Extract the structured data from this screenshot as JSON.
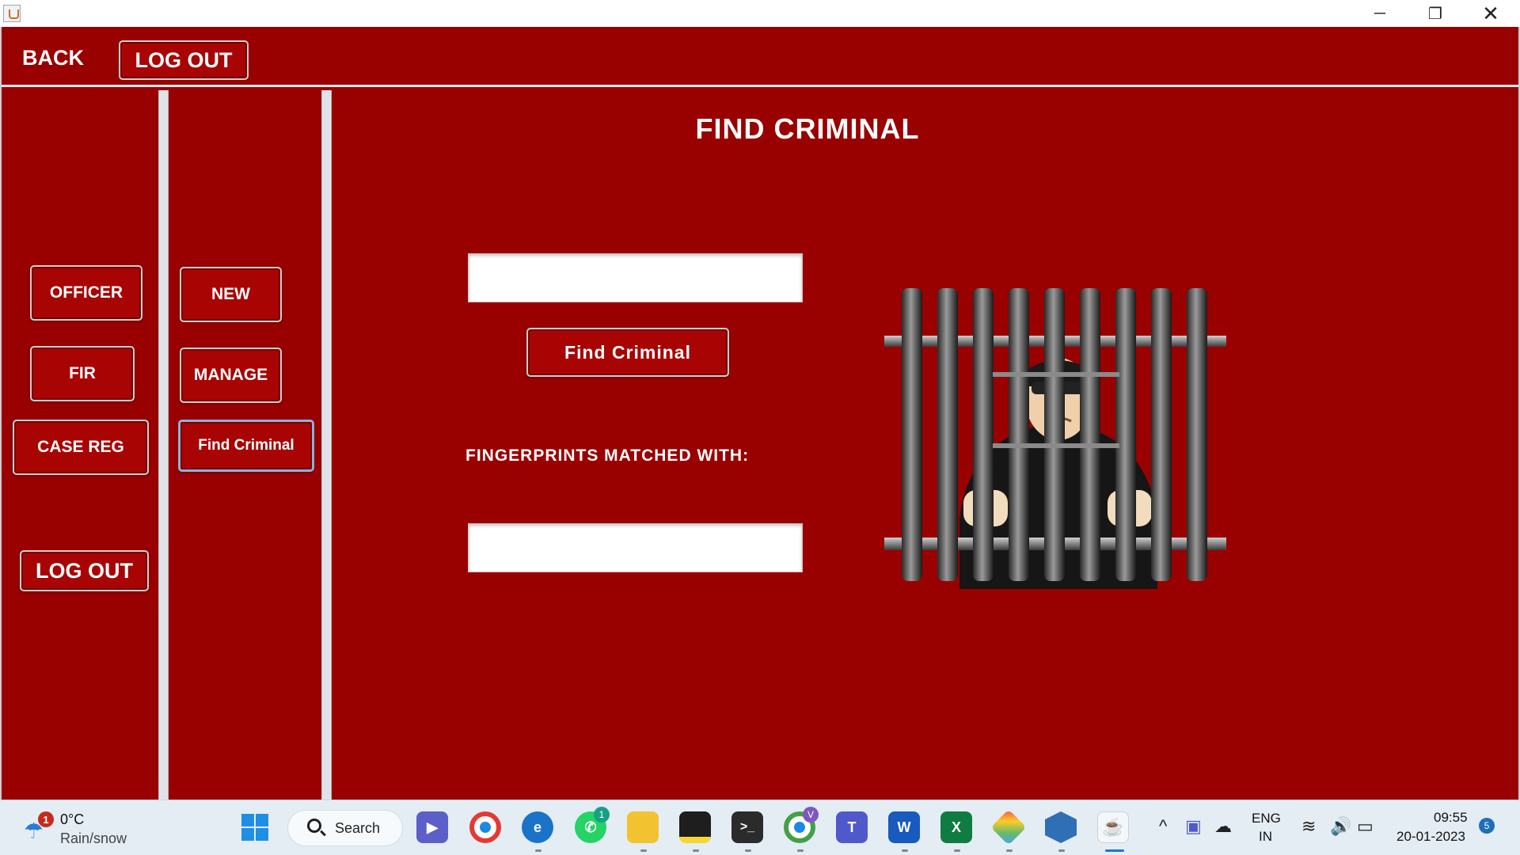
{
  "window": {
    "minimize": "─",
    "maximize": "❐",
    "close": "✕"
  },
  "topbar": {
    "back": "BACK",
    "logout": "LOG OUT"
  },
  "left_menu": {
    "officer": "OFFICER",
    "fir": "FIR",
    "case_reg": "CASE REG",
    "logout": "LOG OUT"
  },
  "sub_menu": {
    "new": "NEW",
    "manage": "MANAGE",
    "find_criminal": "Find Criminal"
  },
  "main": {
    "title": "FIND CRIMINAL",
    "search_value": "",
    "find_button": "Find Criminal",
    "matched_label": "FINGERPRINTS MATCHED WITH:",
    "result_value": ""
  },
  "taskbar": {
    "weather": {
      "badge": "1",
      "temp": "0°C",
      "desc": "Rain/snow"
    },
    "search_label": "Search",
    "whatsapp_badge": "1",
    "chrome_profile_badge": "V",
    "apps": [
      "windows-start",
      "search",
      "zoom",
      "chrome",
      "edge",
      "whatsapp",
      "file-explorer",
      "sticky-notes",
      "terminal",
      "chrome-profile",
      "teams",
      "word",
      "excel",
      "git-kraken",
      "virtualbox",
      "java"
    ],
    "lang_top": "ENG",
    "lang_bottom": "IN",
    "time": "09:55",
    "date": "20-01-2023",
    "notification_count": "5"
  }
}
